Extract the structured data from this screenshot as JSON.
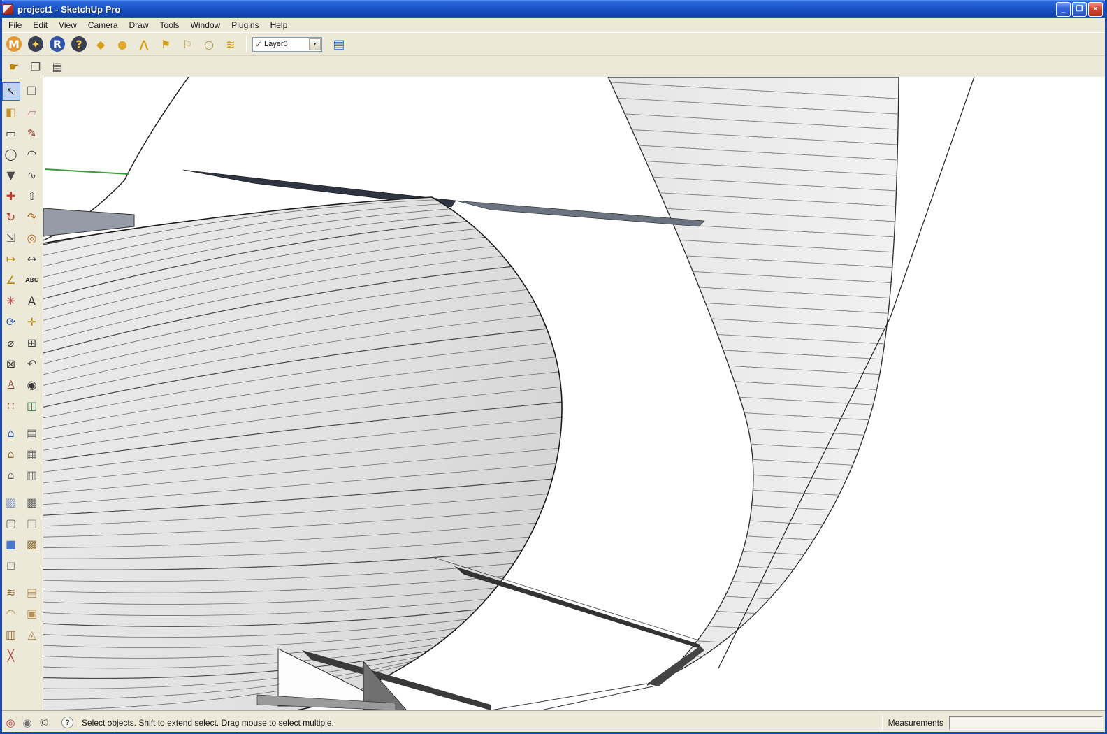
{
  "window": {
    "title": "project1 - SketchUp Pro",
    "controls": [
      {
        "name": "minimize-button",
        "glyph": "_"
      },
      {
        "name": "restore-button",
        "glyph": "❐"
      },
      {
        "name": "close-button",
        "glyph": "×",
        "cls": "close"
      }
    ]
  },
  "menubar": {
    "items": [
      {
        "name": "menu-file",
        "label": "File"
      },
      {
        "name": "menu-edit",
        "label": "Edit"
      },
      {
        "name": "menu-view",
        "label": "View"
      },
      {
        "name": "menu-camera",
        "label": "Camera"
      },
      {
        "name": "menu-draw",
        "label": "Draw"
      },
      {
        "name": "menu-tools",
        "label": "Tools"
      },
      {
        "name": "menu-window",
        "label": "Window"
      },
      {
        "name": "menu-plugins",
        "label": "Plugins"
      },
      {
        "name": "menu-help",
        "label": "Help"
      }
    ]
  },
  "plugin_toolbar": {
    "icons": [
      {
        "name": "m-plugin-icon",
        "glyph": "M",
        "bg": "#e59a2f",
        "color": "#ffffff"
      },
      {
        "name": "compass-plugin-icon",
        "glyph": "✦",
        "bg": "#3a3f52",
        "color": "#ffd24a"
      },
      {
        "name": "r-plugin-icon",
        "glyph": "R",
        "bg": "#2f55a8",
        "color": "#ffffff"
      },
      {
        "name": "help-plugin-icon",
        "glyph": "?",
        "bg": "#3a3f52",
        "color": "#ffd24a"
      },
      {
        "name": "diamond-plugin-icon",
        "glyph": "◆",
        "color": "#d4a017"
      },
      {
        "name": "sphere-plugin-icon",
        "glyph": "●",
        "color": "#e0a82e"
      },
      {
        "name": "roof-plugin-icon",
        "glyph": "⋀",
        "color": "#d4a017"
      },
      {
        "name": "flag-plugin-icon",
        "glyph": "⚑",
        "color": "#d4a017"
      },
      {
        "name": "flag2-plugin-icon",
        "glyph": "⚐",
        "color": "#c09f3f"
      },
      {
        "name": "ring-plugin-icon",
        "glyph": "○",
        "color": "#b09040"
      },
      {
        "name": "weave-plugin-icon",
        "glyph": "≋",
        "color": "#d4a017"
      }
    ],
    "layer_combo": {
      "check": "✓",
      "value": "Layer0",
      "arrow": "▼"
    },
    "layer_manager_glyph": "▤"
  },
  "edit_toolbar": {
    "icons": [
      {
        "name": "hand-icon",
        "glyph": "☛",
        "color": "#b8860b"
      },
      {
        "name": "export-page-icon",
        "glyph": "❐",
        "color": "#555555"
      },
      {
        "name": "print-page-icon",
        "glyph": "▤",
        "color": "#555555"
      }
    ]
  },
  "tool_palette": {
    "main_tools": [
      {
        "name": "select-tool-icon",
        "glyph": "↖",
        "color": "#111111",
        "cls": "active"
      },
      {
        "name": "make-component-tool-icon",
        "glyph": "❒",
        "color": "#555555"
      },
      {
        "name": "paint-bucket-tool-icon",
        "glyph": "◧",
        "color": "#c28f2c"
      },
      {
        "name": "eraser-tool-icon",
        "glyph": "▱",
        "color": "#c97f8f"
      },
      {
        "name": "rectangle-tool-icon",
        "glyph": "▭",
        "color": "#3a3a3a"
      },
      {
        "name": "line-tool-icon",
        "glyph": "✎",
        "color": "#8b3a2a"
      },
      {
        "name": "circle-tool-icon",
        "glyph": "◯",
        "color": "#3a3a3a"
      },
      {
        "name": "arc-tool-icon",
        "glyph": "◠",
        "color": "#3a3a3a"
      },
      {
        "name": "polygon-tool-icon",
        "glyph": "▼",
        "color": "#4a4a4a"
      },
      {
        "name": "freehand-tool-icon",
        "glyph": "∿",
        "color": "#4a4a4a"
      },
      {
        "name": "move-tool-icon",
        "glyph": "✚",
        "color": "#c0392b"
      },
      {
        "name": "push-pull-tool-icon",
        "glyph": "⇧",
        "color": "#555555"
      },
      {
        "name": "rotate-tool-icon",
        "glyph": "↻",
        "color": "#c0392b"
      },
      {
        "name": "follow-me-tool-icon",
        "glyph": "↷",
        "color": "#b5651d"
      },
      {
        "name": "scale-tool-icon",
        "glyph": "⇲",
        "color": "#555555"
      },
      {
        "name": "offset-tool-icon",
        "glyph": "◎",
        "color": "#b5651d"
      },
      {
        "name": "tape-measure-tool-icon",
        "glyph": "↦",
        "color": "#b8860b"
      },
      {
        "name": "dimension-tool-icon",
        "glyph": "↔",
        "color": "#3a3a3a"
      },
      {
        "name": "protractor-tool-icon",
        "glyph": "∠",
        "color": "#b8860b"
      },
      {
        "name": "text-tool-icon",
        "glyph": "ABC",
        "color": "#3a3a3a",
        "cls": "txt"
      },
      {
        "name": "axes-tool-icon",
        "glyph": "✳",
        "color": "#cc3333"
      },
      {
        "name": "3d-text-tool-icon",
        "glyph": "A",
        "color": "#3a3a3a"
      },
      {
        "name": "orbit-tool-icon",
        "glyph": "⟳",
        "color": "#2f55a8"
      },
      {
        "name": "pan-tool-icon",
        "glyph": "✛",
        "color": "#b8860b"
      },
      {
        "name": "zoom-tool-icon",
        "glyph": "⌀",
        "color": "#3a3a3a"
      },
      {
        "name": "zoom-window-tool-icon",
        "glyph": "⊞",
        "color": "#3a3a3a"
      },
      {
        "name": "zoom-extents-tool-icon",
        "glyph": "⊠",
        "color": "#3a3a3a"
      },
      {
        "name": "previous-view-tool-icon",
        "glyph": "↶",
        "color": "#555555"
      },
      {
        "name": "position-camera-tool-icon",
        "glyph": "♙",
        "color": "#8b3e2f"
      },
      {
        "name": "look-around-tool-icon",
        "glyph": "◉",
        "color": "#3a3a3a"
      },
      {
        "name": "walk-tool-icon",
        "glyph": "∷",
        "color": "#8b3e2f"
      },
      {
        "name": "section-plane-tool-icon",
        "glyph": "◫",
        "color": "#2e7d46"
      }
    ],
    "view_tools": [
      {
        "name": "iso-view-icon",
        "glyph": "⌂",
        "color": "#2f55a8"
      },
      {
        "name": "top-view-icon",
        "glyph": "▤",
        "color": "#666666"
      },
      {
        "name": "front-view-icon",
        "glyph": "⌂",
        "color": "#8a6d3b"
      },
      {
        "name": "right-view-icon",
        "glyph": "▦",
        "color": "#666666"
      },
      {
        "name": "back-view-icon",
        "glyph": "⌂",
        "color": "#666666"
      },
      {
        "name": "left-view-icon",
        "glyph": "▥",
        "color": "#666666"
      }
    ],
    "style_tools": [
      {
        "name": "xray-style-icon",
        "glyph": "▨",
        "color": "#7a93c9"
      },
      {
        "name": "back-edges-style-icon",
        "glyph": "▩",
        "color": "#666666"
      },
      {
        "name": "wireframe-style-icon",
        "glyph": "▢",
        "color": "#666666"
      },
      {
        "name": "hidden-line-style-icon",
        "glyph": "□",
        "color": "#888888"
      },
      {
        "name": "shaded-style-icon",
        "glyph": "■",
        "color": "#4a76c9"
      },
      {
        "name": "shaded-textures-style-icon",
        "glyph": "▩",
        "color": "#8a6d3b"
      },
      {
        "name": "monochrome-style-icon",
        "glyph": "◻",
        "color": "#777777"
      }
    ],
    "sandbox_tools": [
      {
        "name": "from-contours-icon",
        "glyph": "≋",
        "color": "#8a6d3b"
      },
      {
        "name": "from-scratch-icon",
        "glyph": "▤",
        "color": "#b5915a"
      },
      {
        "name": "smoove-icon",
        "glyph": "◠",
        "color": "#b5915a"
      },
      {
        "name": "stamp-icon",
        "glyph": "▣",
        "color": "#b5915a"
      },
      {
        "name": "drape-icon",
        "glyph": "▥",
        "color": "#8a6d3b"
      },
      {
        "name": "add-detail-icon",
        "glyph": "◬",
        "color": "#b5915a"
      },
      {
        "name": "flip-edge-icon",
        "glyph": "╳",
        "color": "#a94438"
      }
    ]
  },
  "statusbar": {
    "badges": [
      {
        "name": "credit-badge-icon",
        "glyph": "◎",
        "color": "#cc3333"
      },
      {
        "name": "dot-badge-icon",
        "glyph": "◉",
        "color": "#777777"
      },
      {
        "name": "copyright-badge-icon",
        "glyph": "©",
        "color": "#555555"
      }
    ],
    "help_icon": "?",
    "hint": "Select objects. Shift to extend select. Drag mouse to select multiple.",
    "measurements_label": "Measurements",
    "measurements_value": ""
  },
  "colors": {
    "titlebar": "#1b54c8",
    "chrome": "#ECE9D8",
    "canvas_bg": "#ffffff",
    "close_button": "#d6492f",
    "model_gray": "#e2e2e2",
    "band_gray": "#ebebeb"
  }
}
